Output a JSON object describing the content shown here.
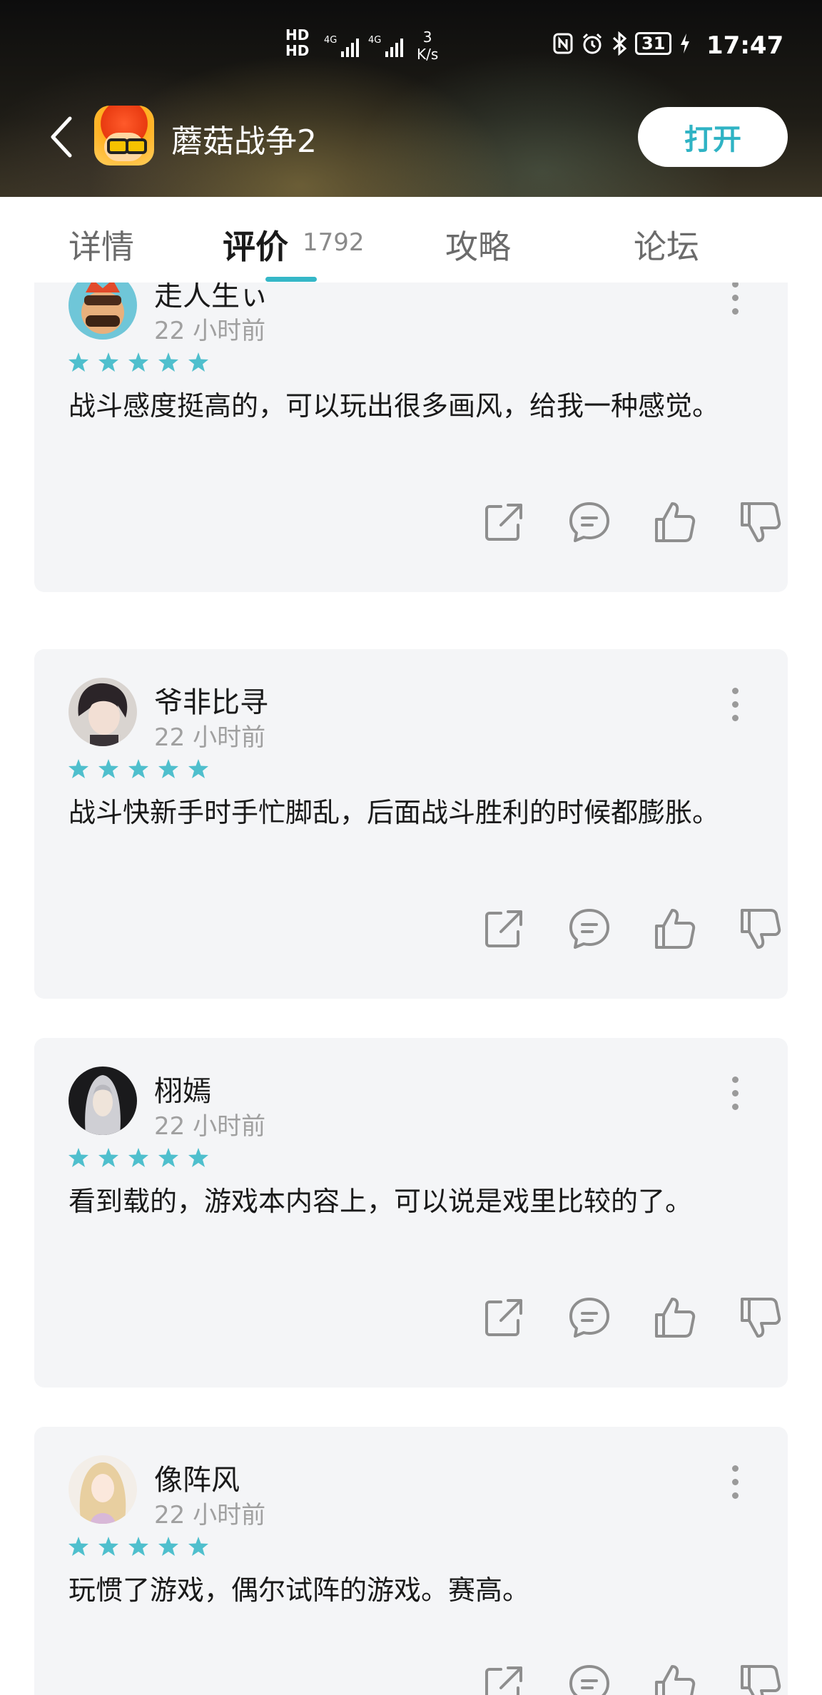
{
  "status_bar": {
    "network_top": "HD",
    "network_bottom": "HD",
    "signal_1": "4G",
    "signal_2": "4G",
    "speed_value": "3",
    "speed_unit": "K/s",
    "battery": "31",
    "time": "17:47"
  },
  "app_bar": {
    "title": "蘑菇战争2",
    "open_button": "打开"
  },
  "tabs": [
    {
      "label": "详情"
    },
    {
      "label": "评价",
      "count": "1792",
      "active": true
    },
    {
      "label": "攻略"
    },
    {
      "label": "论坛"
    }
  ],
  "reviews": [
    {
      "user": "走人生ぃ",
      "time": "22 小时前",
      "rating": 5,
      "text": "战斗感度挺高的，可以玩出很多画风，给我一种感觉。"
    },
    {
      "user": "爷非比寻",
      "time": "22 小时前",
      "rating": 5,
      "text": "战斗快新手时手忙脚乱，后面战斗胜利的时候都膨胀。"
    },
    {
      "user": "栩嫣",
      "time": "22 小时前",
      "rating": 5,
      "text": "看到载的，游戏本内容上，可以说是戏里比较的了。"
    },
    {
      "user": "像阵风",
      "time": "22 小时前",
      "rating": 5,
      "text": "玩惯了游戏，偶尔试阵的游戏。赛高。"
    }
  ],
  "colors": {
    "accent": "#35b7c7",
    "star": "#4fbfcd",
    "card_bg": "#f4f5f7",
    "action_icon": "#8e8e8e"
  },
  "icons": {
    "back": "chevron-left-icon",
    "more": "more-vertical-icon",
    "share": "share-icon",
    "comment": "comment-icon",
    "like": "thumbs-up-icon",
    "dislike": "thumbs-down-icon",
    "star": "star-icon"
  }
}
